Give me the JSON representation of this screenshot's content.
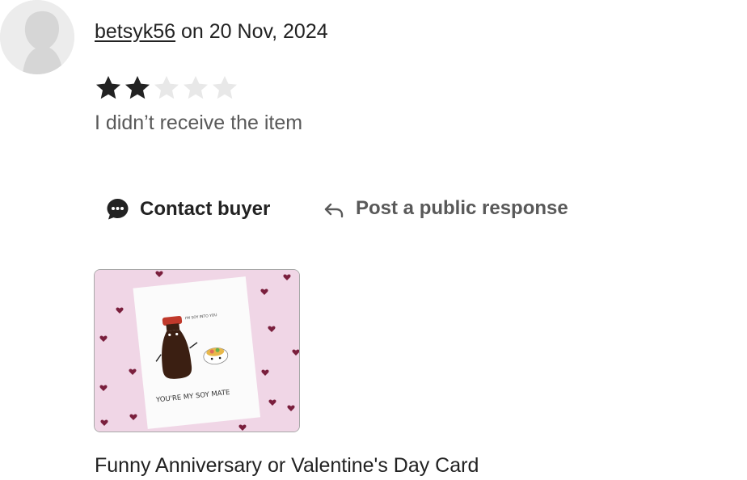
{
  "review": {
    "username": "betsyk56",
    "date_text": " on 20 Nov, 2024",
    "rating": 2,
    "rating_max": 5,
    "text": "I didn’t receive the item"
  },
  "actions": {
    "contact_label": "Contact buyer",
    "respond_label": "Post a public response"
  },
  "listing": {
    "title": "Funny Anniversary or Valentine's Day Card",
    "card_text_top": "I'M SOY INTO YOU",
    "card_caption": "YOU'RE MY SOY MATE"
  },
  "icons": {
    "avatar": "default-avatar-icon",
    "star_filled": "star-filled-icon",
    "star_empty": "star-empty-icon",
    "contact": "chat-bubble-icon",
    "respond": "reply-arrow-icon"
  },
  "colors": {
    "star_filled": "#222222",
    "star_empty": "#e8e8e8",
    "text_primary": "#222222",
    "text_secondary": "#595959",
    "card_background": "#f0d6e6",
    "heart": "#7a1f3d"
  }
}
